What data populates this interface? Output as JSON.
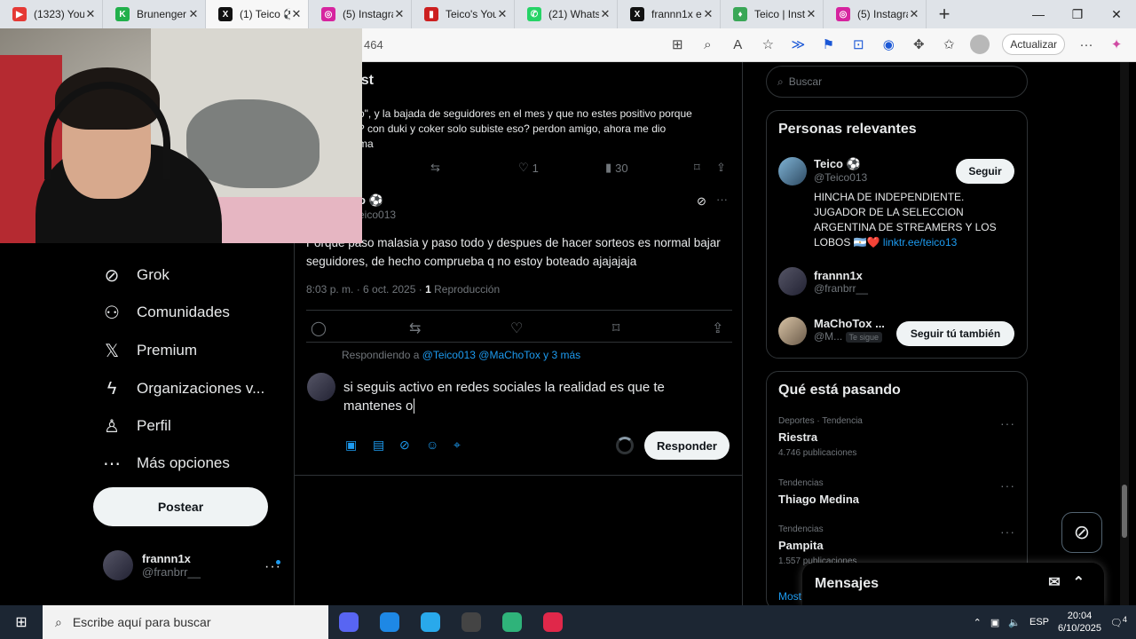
{
  "browser": {
    "tabs": [
      {
        "title": "(1323) YouTu",
        "color": "#e53935",
        "glyph": "▶",
        "active": false
      },
      {
        "title": "Brunenger S",
        "color": "#21b04b",
        "glyph": "K",
        "active": false
      },
      {
        "title": "(1) Teico ⚽",
        "color": "#111111",
        "glyph": "X",
        "active": true
      },
      {
        "title": "(5) Instagrar",
        "color": "#d6249f",
        "glyph": "◎",
        "active": false
      },
      {
        "title": "Teico's YouT",
        "color": "#cc1f1f",
        "glyph": "▮",
        "active": false
      },
      {
        "title": "(21) WhatsA",
        "color": "#25d366",
        "glyph": "✆",
        "active": false
      },
      {
        "title": "frannn1x en",
        "color": "#111111",
        "glyph": "X",
        "active": false
      },
      {
        "title": "Teico | Insta",
        "color": "#3aa757",
        "glyph": "♦",
        "active": false
      },
      {
        "title": "(5) Instagrar",
        "color": "#d6249f",
        "glyph": "◎",
        "active": false
      }
    ],
    "close_glyph": "✕",
    "new_tab": "+",
    "window_controls": [
      "—",
      "❐",
      "✕"
    ],
    "url": "464",
    "update_label": "Actualizar",
    "more": "···"
  },
  "left_nav": {
    "items": [
      {
        "label": "Grok",
        "icon": "grok-icon",
        "glyph": "⊘"
      },
      {
        "label": "Comunidades",
        "icon": "communities-icon",
        "glyph": "⚇"
      },
      {
        "label": "Premium",
        "icon": "x-premium-icon",
        "glyph": "𝕏"
      },
      {
        "label": "Organizaciones v...",
        "icon": "lightning-icon",
        "glyph": "ϟ"
      },
      {
        "label": "Perfil",
        "icon": "person-icon",
        "glyph": "♙"
      },
      {
        "label": "Más opciones",
        "icon": "more-circle-icon",
        "glyph": "⋯"
      }
    ],
    "post_button": "Postear",
    "account": {
      "name": "frannn1x",
      "handle": "@franbrr__",
      "more": "···"
    }
  },
  "center": {
    "header_title": "ost",
    "top_tweet": {
      "line1": "o\", y la bajada de seguidores en el mes y que no estes positivo porque",
      "line2": "?  con duki y coker solo subiste eso? perdon amigo, ahora me dio",
      "line3": "ma",
      "likes": "1",
      "views": "30"
    },
    "main_tweet": {
      "name": "o ⚽",
      "handle": "eico013",
      "text": "Porque paso malasia y paso todo y despues de hacer sorteos es normal bajar seguidores, de hecho comprueba q no estoy boteado ajajajaja",
      "time": "8:03 p. m. · 6 oct. 2025 · ",
      "views_count": "1",
      "views_label": " Reproducción"
    },
    "reply": {
      "replying_prefix": "Respondiendo a ",
      "replying_to": "@Teico013 @MaChoTox y 3 más",
      "text_line1": "si seguis activo en redes sociales la realidad es que  te",
      "text_line2": "mantenes o",
      "button": "Responder"
    }
  },
  "right": {
    "search_placeholder": "Buscar",
    "relevant_title": "Personas relevantes",
    "people": [
      {
        "name": "Teico ⚽",
        "handle": "@Teico013",
        "button": "Seguir",
        "bio": "HINCHA DE INDEPENDIENTE. JUGADOR DE LA SELECCION ARGENTINA DE STREAMERS Y LOS LOBOS 🇦🇷❤️",
        "link": "linktr.ee/teico13"
      },
      {
        "name": "frannn1x",
        "handle": "@franbrr__"
      },
      {
        "name": "MaChoTox ...",
        "handle": "@M...",
        "badge": "Te sigue",
        "button": "Seguir tú también"
      }
    ],
    "trending_title": "Qué está pasando",
    "trends": [
      {
        "category": "Deportes · Tendencia",
        "name": "Riestra",
        "count": "4.746 publicaciones"
      },
      {
        "category": "Tendencias",
        "name": "Thiago Medina",
        "count": ""
      },
      {
        "category": "Tendencias",
        "name": "Pampita",
        "count": "1.557 publicaciones"
      }
    ],
    "show_more": "Most",
    "messages": "Mensajes"
  },
  "taskbar": {
    "search_placeholder": "Escribe aquí para buscar",
    "lang": "ESP",
    "time": "20:04",
    "date": "6/10/2025",
    "notif_count": "4",
    "apps": [
      {
        "name": "app-discord",
        "color": "#5865f2"
      },
      {
        "name": "app-edge",
        "color": "#1e88e5"
      },
      {
        "name": "app-telegram",
        "color": "#29a9eb"
      },
      {
        "name": "app-obs",
        "color": "#444444"
      },
      {
        "name": "app-edge-beta",
        "color": "#2fb37a"
      },
      {
        "name": "app-red",
        "color": "#e0284a"
      }
    ]
  }
}
